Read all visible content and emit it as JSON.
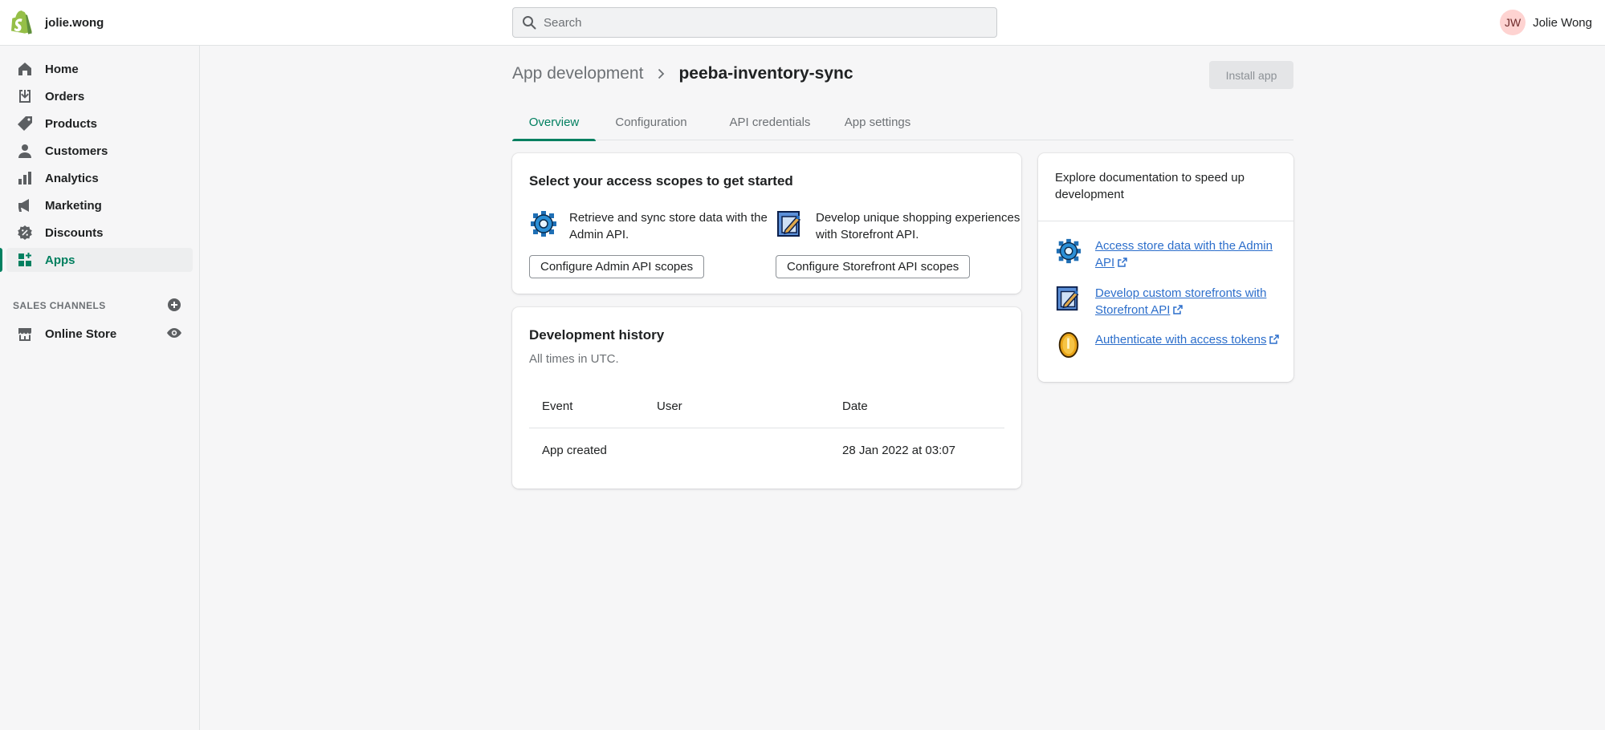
{
  "topbar": {
    "store_name": "jolie.wong",
    "search_placeholder": "Search",
    "user_initials": "JW",
    "user_name": "Jolie Wong"
  },
  "sidebar": {
    "items": [
      {
        "label": "Home",
        "icon": "home-icon"
      },
      {
        "label": "Orders",
        "icon": "orders-icon"
      },
      {
        "label": "Products",
        "icon": "tag-icon"
      },
      {
        "label": "Customers",
        "icon": "person-icon"
      },
      {
        "label": "Analytics",
        "icon": "bar-chart-icon"
      },
      {
        "label": "Marketing",
        "icon": "megaphone-icon"
      },
      {
        "label": "Discounts",
        "icon": "discount-icon"
      },
      {
        "label": "Apps",
        "icon": "apps-icon",
        "active": true
      }
    ],
    "sales_channels_title": "SALES CHANNELS",
    "online_store_label": "Online Store"
  },
  "header": {
    "breadcrumb_parent": "App development",
    "title": "peeba-inventory-sync",
    "install_button": "Install app"
  },
  "tabs": [
    {
      "label": "Overview",
      "active": true
    },
    {
      "label": "Configuration"
    },
    {
      "label": "API credentials"
    },
    {
      "label": "App settings"
    }
  ],
  "scopes_card": {
    "title": "Select your access scopes to get started",
    "admin_text": "Retrieve and sync store data with the Admin API.",
    "admin_button": "Configure Admin API scopes",
    "storefront_text": "Develop unique shopping experiences with Storefront API.",
    "storefront_button": "Configure Storefront API scopes"
  },
  "history_card": {
    "title": "Development history",
    "subtitle": "All times in UTC.",
    "columns": [
      "Event",
      "User",
      "Date"
    ],
    "rows": [
      {
        "event": "App created",
        "user": "",
        "date": "28 Jan 2022 at 03:07"
      }
    ]
  },
  "docs_card": {
    "title": "Explore documentation to speed up development",
    "links": [
      {
        "text": "Access store data with the Admin API",
        "icon": "gear-icon"
      },
      {
        "text": "Develop custom storefronts with Storefront API",
        "icon": "storefront-icon"
      },
      {
        "text": "Authenticate with access tokens",
        "icon": "coin-icon"
      }
    ]
  },
  "colors": {
    "accent": "#008060",
    "link": "#2c6ecb",
    "muted": "#6d7175",
    "avatar_bg": "#fed3d1"
  }
}
